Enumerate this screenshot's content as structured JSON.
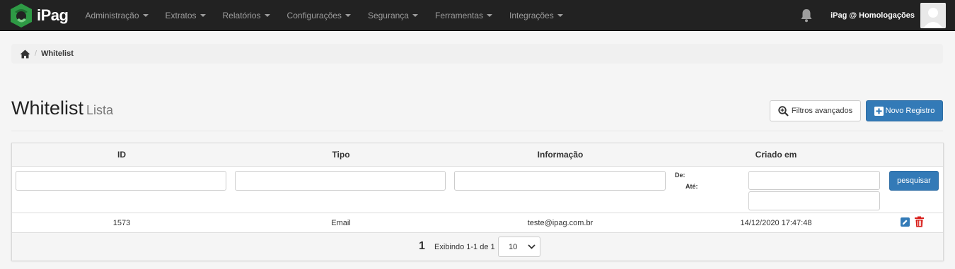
{
  "brand": {
    "name": "iPag"
  },
  "nav": {
    "items": [
      {
        "label": "Administração"
      },
      {
        "label": "Extratos"
      },
      {
        "label": "Relatórios"
      },
      {
        "label": "Configurações"
      },
      {
        "label": "Segurança"
      },
      {
        "label": "Ferramentas"
      },
      {
        "label": "Integrações"
      }
    ],
    "user": "iPag @ Homologações"
  },
  "breadcrumb": {
    "current": "Whitelist"
  },
  "header": {
    "title": "Whitelist",
    "subtitle": "Lista",
    "filter_button": "Filtros avançados",
    "new_button": "Novo Registro"
  },
  "table": {
    "columns": [
      "ID",
      "Tipo",
      "Informação",
      "Criado em"
    ],
    "filters": {
      "id_value": "",
      "tipo_value": "",
      "info_value": "",
      "de_label": "De:",
      "ate_label": "Até:",
      "de_value": "",
      "ate_value": "",
      "search_button": "pesquisar"
    },
    "rows": [
      {
        "id": "1573",
        "tipo": "Email",
        "info": "teste@ipag.com.br",
        "created": "14/12/2020 17:47:48"
      }
    ],
    "pagination": {
      "page": "1",
      "info": "Exibindo 1-1 de 1",
      "per_page": "10"
    }
  },
  "colors": {
    "navbar": "#222222",
    "primary": "#337ab7",
    "danger": "#d9201c",
    "brand_green": "#2e9a45"
  }
}
